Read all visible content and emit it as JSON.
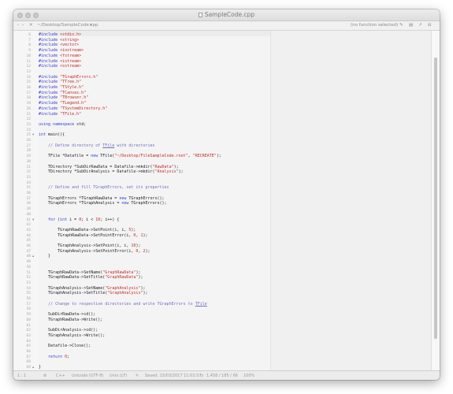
{
  "window": {
    "title": "SampleCode.cpp",
    "path_label": "~/Desktop/SampleCode.cpp",
    "function_label": "(no function selected)"
  },
  "statusbar": {
    "line_col": "1 : 1",
    "language": "C++",
    "encoding": "Unicode (UTF-8)",
    "line_endings": "Unix (LF)",
    "saved": "Saved: 15/03/2017 11:02:57",
    "stats": "1,458 / 185 / 66",
    "zoom": "100%"
  },
  "code_lines": [
    {
      "n": "6",
      "t": [
        [
          "pp",
          "#include "
        ],
        [
          "inc",
          "<stdio.h>"
        ]
      ]
    },
    {
      "n": "7",
      "t": [
        [
          "pp",
          "#include "
        ],
        [
          "inc",
          "<string>"
        ]
      ]
    },
    {
      "n": "8",
      "t": [
        [
          "pp",
          "#include "
        ],
        [
          "inc",
          "<vector>"
        ]
      ]
    },
    {
      "n": "9",
      "t": [
        [
          "pp",
          "#include "
        ],
        [
          "inc",
          "<iostream>"
        ]
      ]
    },
    {
      "n": "10",
      "t": [
        [
          "pp",
          "#include "
        ],
        [
          "inc",
          "<fstream>"
        ]
      ]
    },
    {
      "n": "11",
      "t": [
        [
          "pp",
          "#include "
        ],
        [
          "inc",
          "<istream>"
        ]
      ]
    },
    {
      "n": "12",
      "t": [
        [
          "pp",
          "#include "
        ],
        [
          "inc",
          "<sstream>"
        ]
      ]
    },
    {
      "n": "13",
      "t": []
    },
    {
      "n": "14",
      "t": [
        [
          "pp",
          "#include "
        ],
        [
          "inc",
          "\"TGraphErrors.h\""
        ]
      ]
    },
    {
      "n": "15",
      "t": [
        [
          "pp",
          "#include "
        ],
        [
          "inc",
          "\"TTree.h\""
        ]
      ]
    },
    {
      "n": "16",
      "t": [
        [
          "pp",
          "#include "
        ],
        [
          "inc",
          "\"TStyle.h\""
        ]
      ]
    },
    {
      "n": "17",
      "t": [
        [
          "pp",
          "#include "
        ],
        [
          "inc",
          "\"TCanvas.h\""
        ]
      ]
    },
    {
      "n": "18",
      "t": [
        [
          "pp",
          "#include "
        ],
        [
          "inc",
          "\"TBrowser.h\""
        ]
      ]
    },
    {
      "n": "19",
      "t": [
        [
          "pp",
          "#include "
        ],
        [
          "inc",
          "\"TLegend.h\""
        ]
      ]
    },
    {
      "n": "20",
      "t": [
        [
          "pp",
          "#include "
        ],
        [
          "inc",
          "\"TSystemDirectory.h\""
        ]
      ]
    },
    {
      "n": "21",
      "t": [
        [
          "pp",
          "#include "
        ],
        [
          "inc",
          "\"TFile.h\""
        ]
      ]
    },
    {
      "n": "22",
      "t": []
    },
    {
      "n": "23",
      "t": [
        [
          "kw",
          "using namespace "
        ],
        [
          "ty",
          "std;"
        ]
      ]
    },
    {
      "n": "24",
      "t": []
    },
    {
      "n": "25",
      "fold": "▾",
      "t": [
        [
          "kw",
          "int "
        ],
        [
          "ty",
          "main(){"
        ]
      ]
    },
    {
      "n": "26",
      "t": []
    },
    {
      "n": "27",
      "t": [
        [
          "ty",
          "    "
        ],
        [
          "cm",
          "// Define directory of "
        ],
        [
          "cmu",
          "TFile"
        ],
        [
          "cm",
          " with directories"
        ]
      ]
    },
    {
      "n": "28",
      "t": []
    },
    {
      "n": "29",
      "t": [
        [
          "ty",
          "    TFile *Datafile = "
        ],
        [
          "kw",
          "new "
        ],
        [
          "ty",
          "TFile("
        ],
        [
          "str",
          "\"~/Desktop/FileSampleCode.root\""
        ],
        [
          "ty",
          ", "
        ],
        [
          "str",
          "\"RECREATE\""
        ],
        [
          "ty",
          ");"
        ]
      ]
    },
    {
      "n": "30",
      "t": []
    },
    {
      "n": "31",
      "t": [
        [
          "ty",
          "    TDirectory *SubDirRawData = Datafile->mkdir("
        ],
        [
          "str",
          "\"RawData\""
        ],
        [
          "ty",
          ");"
        ]
      ]
    },
    {
      "n": "32",
      "t": [
        [
          "ty",
          "    TDirectory *SubDirAnalysis = Datafile->mkdir("
        ],
        [
          "str",
          "\"Analysis\""
        ],
        [
          "ty",
          ");"
        ]
      ]
    },
    {
      "n": "33",
      "t": []
    },
    {
      "n": "34",
      "t": []
    },
    {
      "n": "35",
      "t": [
        [
          "ty",
          "    "
        ],
        [
          "cm",
          "// Define and fill TGraphErrors, set its properties"
        ]
      ]
    },
    {
      "n": "36",
      "t": []
    },
    {
      "n": "37",
      "t": [
        [
          "ty",
          "    TGraphErrors *TGraphRawData = "
        ],
        [
          "kw",
          "new "
        ],
        [
          "ty",
          "TGraphErrors();"
        ]
      ]
    },
    {
      "n": "38",
      "t": [
        [
          "ty",
          "    TGraphErrors *TGraphAnalysis = "
        ],
        [
          "kw",
          "new "
        ],
        [
          "ty",
          "TGraphErrors();"
        ]
      ]
    },
    {
      "n": "39",
      "t": []
    },
    {
      "n": "40",
      "t": []
    },
    {
      "n": "41",
      "fold": "▾",
      "t": [
        [
          "ty",
          "    "
        ],
        [
          "kw",
          "for "
        ],
        [
          "ty",
          "("
        ],
        [
          "kw",
          "int "
        ],
        [
          "ty",
          "i = "
        ],
        [
          "num",
          "0"
        ],
        [
          "ty",
          "; i < "
        ],
        [
          "num",
          "10"
        ],
        [
          "ty",
          "; i++) {"
        ]
      ]
    },
    {
      "n": "42",
      "t": []
    },
    {
      "n": "43",
      "t": [
        [
          "ty",
          "        TGraphRawData->SetPoint(i, i, "
        ],
        [
          "num",
          "5"
        ],
        [
          "ty",
          ");"
        ]
      ]
    },
    {
      "n": "44",
      "t": [
        [
          "ty",
          "        TGraphRawData->SetPointError(i, "
        ],
        [
          "num",
          "0"
        ],
        [
          "ty",
          ", "
        ],
        [
          "num",
          "1"
        ],
        [
          "ty",
          ");"
        ]
      ]
    },
    {
      "n": "45",
      "t": []
    },
    {
      "n": "46",
      "t": [
        [
          "ty",
          "        TGraphAnalysis->SetPoint(i, i, "
        ],
        [
          "num",
          "10"
        ],
        [
          "ty",
          ");"
        ]
      ]
    },
    {
      "n": "47",
      "t": [
        [
          "ty",
          "        TGraphAnalysis->SetPointError(i, "
        ],
        [
          "num",
          "0"
        ],
        [
          "ty",
          ", "
        ],
        [
          "num",
          "2"
        ],
        [
          "ty",
          ");"
        ]
      ]
    },
    {
      "n": "48",
      "fold": "▴",
      "t": [
        [
          "ty",
          "    }"
        ]
      ]
    },
    {
      "n": "49",
      "t": []
    },
    {
      "n": "50",
      "t": []
    },
    {
      "n": "51",
      "t": [
        [
          "ty",
          "    TGraphRawData->SetName("
        ],
        [
          "str",
          "\"GraphRawData\""
        ],
        [
          "ty",
          ");"
        ]
      ]
    },
    {
      "n": "52",
      "t": [
        [
          "ty",
          "    TGraphRawData->SetTitle("
        ],
        [
          "str",
          "\"GraphRawData\""
        ],
        [
          "ty",
          ");"
        ]
      ]
    },
    {
      "n": "53",
      "t": []
    },
    {
      "n": "54",
      "t": [
        [
          "ty",
          "    TGraphAnalysis->SetName("
        ],
        [
          "str",
          "\"GraphAnalysis\""
        ],
        [
          "ty",
          ");"
        ]
      ]
    },
    {
      "n": "55",
      "t": [
        [
          "ty",
          "    TGraphAnalysis->SetTitle("
        ],
        [
          "str",
          "\"GraphAnalysis\""
        ],
        [
          "ty",
          ");"
        ]
      ]
    },
    {
      "n": "56",
      "t": []
    },
    {
      "n": "57",
      "t": [
        [
          "ty",
          "    "
        ],
        [
          "cm",
          "// Change to respective directories and write TGraphErrors to "
        ],
        [
          "cmu",
          "TFile"
        ]
      ]
    },
    {
      "n": "58",
      "t": []
    },
    {
      "n": "59",
      "t": [
        [
          "ty",
          "    SubDirRawData->cd();"
        ]
      ]
    },
    {
      "n": "60",
      "t": [
        [
          "ty",
          "    TGraphRawData->Write();"
        ]
      ]
    },
    {
      "n": "61",
      "t": []
    },
    {
      "n": "62",
      "t": [
        [
          "ty",
          "    SubDirAnalysis->cd();"
        ]
      ]
    },
    {
      "n": "63",
      "t": [
        [
          "ty",
          "    TGraphAnalysis->Write();"
        ]
      ]
    },
    {
      "n": "64",
      "t": []
    },
    {
      "n": "65",
      "t": [
        [
          "ty",
          "    Datafile->Close();"
        ]
      ]
    },
    {
      "n": "66",
      "t": []
    },
    {
      "n": "67",
      "t": [
        [
          "ty",
          "    "
        ],
        [
          "kw",
          "return "
        ],
        [
          "num",
          "0"
        ],
        [
          "ty",
          ";"
        ]
      ]
    },
    {
      "n": "68",
      "t": []
    },
    {
      "n": "69",
      "fold": "▴",
      "t": [
        [
          "ty",
          "}"
        ]
      ]
    }
  ]
}
